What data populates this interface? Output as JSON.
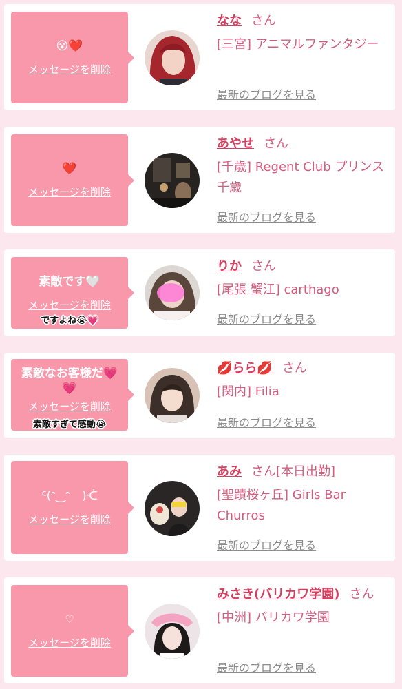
{
  "messages": [
    {
      "text": "😵❤️",
      "delete_label": "メッセージを削除",
      "girl_name": "なな",
      "honorific": "さん",
      "shop": "[三宮] アニマルファンタジー",
      "blog_label": "最新のブログを見る",
      "avatar_icon": "avatar-photo"
    },
    {
      "text": "❤️",
      "delete_label": "メッセージを削除",
      "girl_name": "あやせ",
      "honorific": "さん",
      "shop": "[千歳] Regent Club プリンス 千歳",
      "blog_label": "最新のブログを見る",
      "avatar_icon": "avatar-photo"
    },
    {
      "text": "素敵です🤍",
      "delete_label": "メッセージを削除",
      "sticker": "ですよね😭💗",
      "girl_name": "りか",
      "honorific": "さん",
      "shop": "[尾張 蟹江] carthago",
      "blog_label": "最新のブログを見る",
      "avatar_icon": "avatar-photo"
    },
    {
      "text": "素敵なお客様だ💗💗",
      "delete_label": "メッセージを削除",
      "sticker": "素敵すぎて感動😭",
      "girl_name": "💋らら💋",
      "honorific": "さん",
      "shop": "[関内] Filia",
      "blog_label": "最新のブログを見る",
      "avatar_icon": "avatar-photo"
    },
    {
      "text": "ᑦ(ᵔ‿ᵔ　)ᑣ",
      "delete_label": "メッセージを削除",
      "girl_name": "あみ",
      "honorific": "さん[本日出勤]",
      "shop": "[聖蹟桜ヶ丘] Girls Bar Churros",
      "blog_label": "最新のブログを見る",
      "avatar_icon": "avatar-photo"
    },
    {
      "text": "♡",
      "delete_label": "メッセージを削除",
      "girl_name": "みさき(バリカワ学園)",
      "honorific": "さん",
      "shop": "[中洲] バリカワ学園",
      "blog_label": "最新のブログを見る",
      "avatar_icon": "avatar-photo"
    }
  ],
  "colors": {
    "page_bg": "#fde7ee",
    "bubble": "#fa98ab",
    "name": "#d3405f",
    "text": "#d45d7e",
    "link_gray": "#8c8c8c"
  }
}
